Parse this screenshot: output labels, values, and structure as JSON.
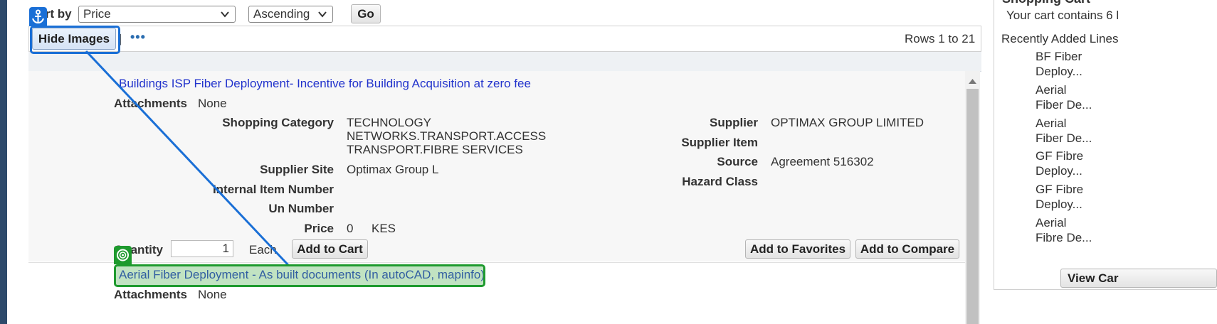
{
  "sort": {
    "label": "Sort by",
    "field_value": "Price",
    "order_value": "Ascending",
    "go_label": "Go"
  },
  "toolbar": {
    "hide_images_label": "Hide Images",
    "separator": "|",
    "more_label": "•••",
    "rows_text": "Rows 1 to 21"
  },
  "items": [
    {
      "title": "Buildings ISP Fiber Deployment- Incentive for Building Acquisition at zero fee",
      "attachments_label": "Attachments",
      "attachments_value": "None",
      "shopping_category_label": "Shopping Category",
      "shopping_category_lines": [
        "TECHNOLOGY",
        "NETWORKS.TRANSPORT.ACCESS",
        "TRANSPORT.FIBRE SERVICES"
      ],
      "supplier_site_label": "Supplier Site",
      "supplier_site_value": "Optimax Group L",
      "internal_item_label": "Internal Item Number",
      "un_number_label": "Un Number",
      "price_label": "Price",
      "price_value": "0",
      "currency": "KES",
      "supplier_label": "Supplier",
      "supplier_value": "OPTIMAX GROUP LIMITED",
      "supplier_item_label": "Supplier Item",
      "source_label": "Source",
      "source_value": "Agreement 516302",
      "hazard_class_label": "Hazard Class",
      "quantity_label": "Quantity",
      "quantity_value": "1",
      "uom": "Each",
      "add_to_cart_label": "Add to Cart",
      "add_to_favorites_label": "Add to Favorites",
      "add_to_compare_label": "Add to Compare"
    },
    {
      "title": "Aerial Fiber Deployment - As built documents (In autoCAD, mapinfo)",
      "attachments_label": "Attachments",
      "attachments_value": "None"
    }
  ],
  "cart": {
    "title": "Shopping Cart",
    "summary": "Your cart contains 6 l",
    "recent_label": "Recently Added Lines",
    "lines": [
      [
        "BF Fiber",
        "Deploy..."
      ],
      [
        "Aerial",
        "Fiber De..."
      ],
      [
        "Aerial",
        "Fiber De..."
      ],
      [
        "GF Fibre",
        "Deploy..."
      ],
      [
        "GF Fibre",
        "Deploy..."
      ],
      [
        "Aerial",
        "Fibre De..."
      ]
    ],
    "view_cart_label": "View Car"
  },
  "colors": {
    "link": "#2233cc",
    "highlight_blue": "#1a6fd6",
    "highlight_green": "#1e9a2e",
    "strip": "#2e4a6b"
  }
}
